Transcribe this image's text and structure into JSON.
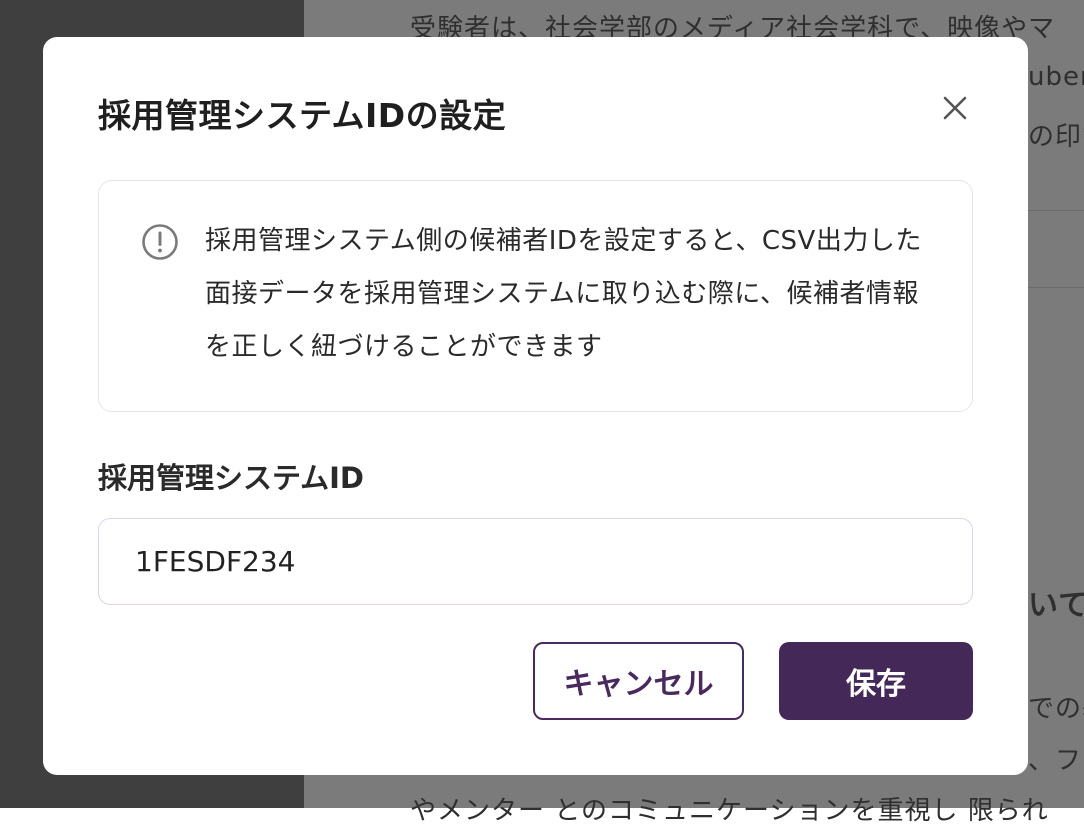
{
  "background": {
    "lines": [
      "受験者は、社会学部のメディア社会学科で、映像やマ",
      "uber",
      "の印象",
      "いて",
      "での基",
      "、フ",
      "やメンター とのコミュニケーションを重視し 限られ"
    ]
  },
  "dialog": {
    "title": "採用管理システムIDの設定",
    "close_icon": "close-icon",
    "info": {
      "icon": "exclamation-circle-icon",
      "text": "採用管理システム側の候補者IDを設定すると、CSV出力した面接データを採用管理システムに取り込む際に、候補者情報を正しく紐づけることができます"
    },
    "field": {
      "label": "採用管理システムID",
      "value": "1FESDF234"
    },
    "buttons": {
      "cancel_label": "キャンセル",
      "save_label": "保存"
    }
  },
  "colors": {
    "primary": "#432858",
    "overlay_dark": "#3f3f3f",
    "overlay_light": "#7b7b7b",
    "input_border": "#e0d3ea"
  }
}
